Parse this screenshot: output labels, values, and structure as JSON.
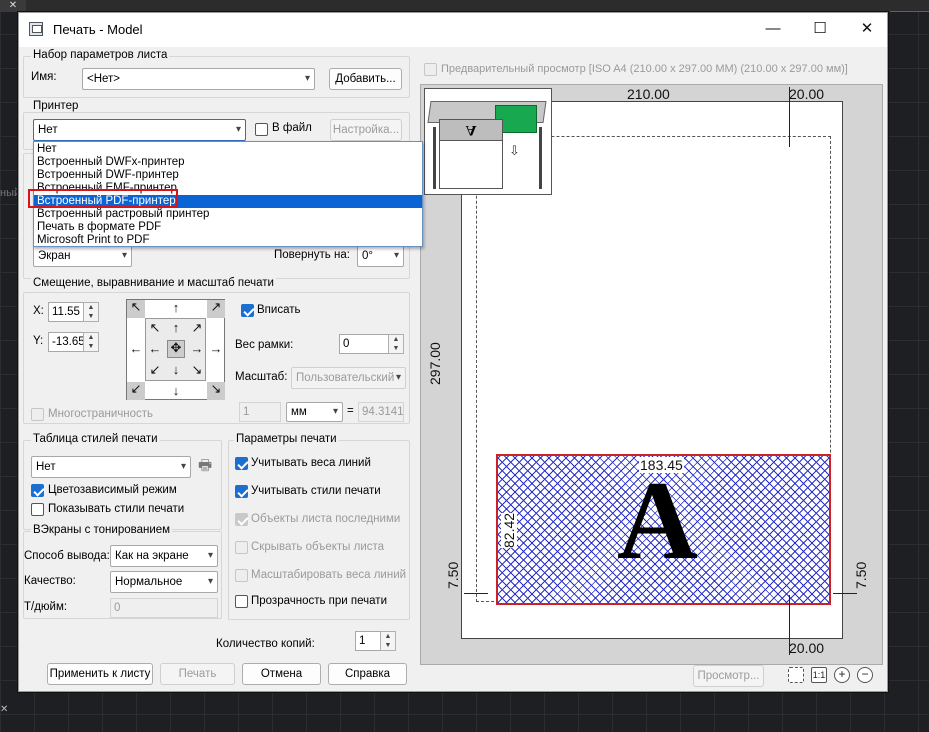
{
  "window": {
    "title": "Печать - Model",
    "minimize_glyph": "—",
    "maximize_glyph": "☐",
    "close_glyph": "✕"
  },
  "bg_texts": {
    "left_partial": "ный",
    "top_close": "✕",
    "bottom_close": "✕"
  },
  "page_setup": {
    "group_label": "Набор параметров листа",
    "name_label": "Имя:",
    "name_value": "<Нет>",
    "add_button": "Добавить..."
  },
  "printer": {
    "group_label": "Принтер",
    "selected": "Нет",
    "to_file_label": "В файл",
    "settings_button": "Настройка...",
    "options": [
      "Нет",
      "Встроенный DWFx-принтер",
      "Встроенный DWF-принтер",
      "Встроенный EMF-принтер",
      "Встроенный PDF-принтер",
      "Встроенный растровый принтер",
      "Печать в формате PDF",
      "Microsoft Print to PDF"
    ],
    "highlighted_index": 4
  },
  "area": {
    "what_value": "Экран",
    "rotate_label": "Повернуть на:",
    "rotate_value": "0°"
  },
  "offset": {
    "group_label": "Смещение, выравнивание и масштаб печати",
    "x_label": "X:",
    "x_value": "11.55",
    "y_label": "Y:",
    "y_value": "-13.65",
    "fit_label": "Вписать",
    "border_label": "Вес рамки:",
    "border_value": "0",
    "scale_label": "Масштаб:",
    "scale_value": "Пользовательский",
    "multipage_label": "Многостраничность",
    "ratio_left": "1",
    "unit_value": "мм",
    "equals": "=",
    "ratio_right": "94.3141"
  },
  "style_table": {
    "group_label": "Таблица стилей печати",
    "value": "Нет",
    "color_dependent_label": "Цветозависимый режим",
    "show_styles_label": "Показывать стили печати"
  },
  "shaded": {
    "group_label": "ВЭкраны с тонированием",
    "output_label": "Способ вывода:",
    "output_value": "Как на экране",
    "quality_label": "Качество:",
    "quality_value": "Нормальное",
    "dpi_label": "Т/дюйм:",
    "dpi_value": "0"
  },
  "print_options": {
    "group_label": "Параметры печати",
    "items": [
      {
        "label": "Учитывать веса линий",
        "checked": true,
        "disabled": false
      },
      {
        "label": "Учитывать стили печати",
        "checked": true,
        "disabled": false
      },
      {
        "label": "Объекты листа последними",
        "checked": true,
        "disabled": true
      },
      {
        "label": "Скрывать объекты листа",
        "checked": false,
        "disabled": true
      },
      {
        "label": "Масштабировать веса линий",
        "checked": false,
        "disabled": true
      },
      {
        "label": "Прозрачность при печати",
        "checked": false,
        "disabled": false
      }
    ]
  },
  "copies": {
    "label": "Количество копий:",
    "value": "1"
  },
  "buttons": {
    "apply": "Применить к листу",
    "print": "Печать",
    "cancel": "Отмена",
    "help": "Справка",
    "preview": "Просмотр..."
  },
  "preview": {
    "header": "Предварительный просмотр [ISO A4 (210.00 x 297.00 MM) (210.00 x 297.00 мм)]",
    "width": "210.00",
    "height": "297.00",
    "top_margin": "20.00",
    "bottom_margin": "20.00",
    "left_margin": "7.50",
    "right_margin": "7.50",
    "area_width": "183.45",
    "area_height": "82.42",
    "letter": "A",
    "paper_letter": "A"
  },
  "zoom_icons": [
    "fit-window-icon",
    "actual-size-icon",
    "zoom-in-icon",
    "zoom-out-icon"
  ],
  "zoom_labels": {
    "actual": "1:1",
    "in": "+",
    "out": "−"
  },
  "colors": {
    "accent": "#0a64d3",
    "highlight_red": "#d6141a",
    "hatch_blue": "#2a30c8"
  }
}
